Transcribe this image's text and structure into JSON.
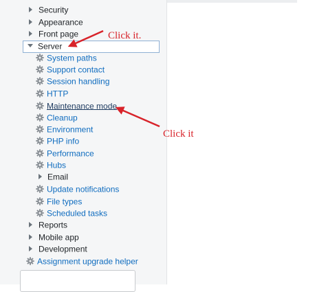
{
  "nav": {
    "security": "Security",
    "appearance": "Appearance",
    "front_page": "Front page",
    "server": "Server",
    "server_children": [
      "System paths",
      "Support contact",
      "Session handling",
      "HTTP",
      "Maintenance mode",
      "Cleanup",
      "Environment",
      "PHP info",
      "Performance",
      "Hubs"
    ],
    "email": "Email",
    "update_notifications": "Update notifications",
    "file_types": "File types",
    "scheduled_tasks": "Scheduled tasks",
    "reports": "Reports",
    "mobile_app": "Mobile app",
    "development": "Development",
    "assignment_upgrade_helper": "Assignment upgrade helper"
  },
  "annotations": {
    "server_note": "Click it.",
    "maintenance_note": "Click it"
  },
  "colors": {
    "link": "#0f6cbf",
    "annotation": "#d8232a",
    "sidebar_bg": "#f5f6f7"
  },
  "icons": {
    "expand": "triangle-right-icon",
    "collapse": "triangle-down-icon",
    "settings": "gear-icon"
  }
}
